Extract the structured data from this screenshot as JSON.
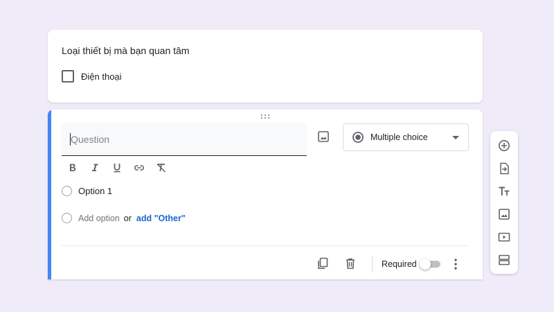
{
  "question1": {
    "title": "Loại thiết bị mà bạn quan tâm",
    "options": [
      {
        "label": "Điện thoại",
        "checked": false
      }
    ]
  },
  "question2": {
    "question_placeholder": "Question",
    "question_value": "",
    "type_label": "Multiple choice",
    "options": [
      {
        "label": "Option 1"
      }
    ],
    "add_option_label": "Add option",
    "or_label": "or",
    "add_other_label": "add \"Other\"",
    "required_label": "Required",
    "required": false,
    "accent_color": "#4285f4"
  },
  "format_toolbar": [
    "bold-icon",
    "italic-icon",
    "underline-icon",
    "link-icon",
    "clear-format-icon"
  ],
  "side_toolbar": [
    "add-question-icon",
    "import-questions-icon",
    "add-title-icon",
    "add-image-icon",
    "add-video-icon",
    "add-section-icon"
  ],
  "colors": {
    "background": "#efebf8",
    "link": "#1967d2",
    "text": "#202124"
  }
}
